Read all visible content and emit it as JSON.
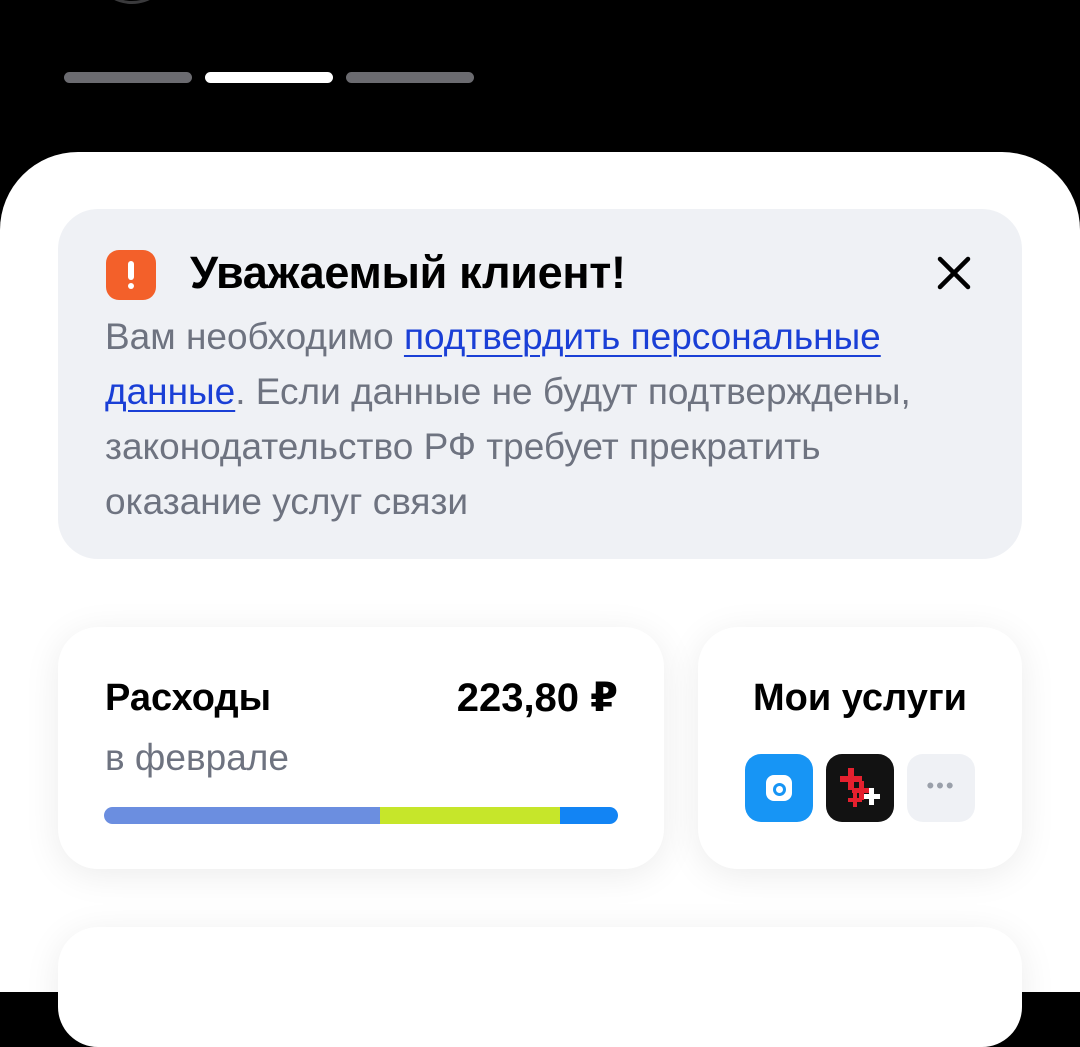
{
  "alert": {
    "title": "Уважаемый клиент!",
    "body_before": "Вам необходимо ",
    "body_link": "подтвердить персональные данные",
    "body_after": ". Если данные не будут подтверждены, законодательство РФ требует прекратить оказание услуг связи",
    "icon": "warning-icon",
    "accent_color": "#f3602a",
    "link_color": "#1a3fd6"
  },
  "stories": {
    "count": 3,
    "active_index": 1
  },
  "expenses": {
    "title": "Расходы",
    "amount": "223,80 ₽",
    "period": "в феврале",
    "segments": [
      {
        "fraction": 0.537,
        "color": "#6b8ee0"
      },
      {
        "fraction": 0.35,
        "color": "#c6e62a"
      },
      {
        "fraction": 0.113,
        "color": "#1284f4"
      }
    ]
  },
  "services": {
    "title": "Мои услуги",
    "tiles": [
      {
        "icon": "service-blue-icon",
        "color": "#1795f5"
      },
      {
        "icon": "service-plus-icon",
        "color": "#121212"
      },
      {
        "icon": "more-dots-icon",
        "color": "#eff1f5"
      }
    ]
  }
}
